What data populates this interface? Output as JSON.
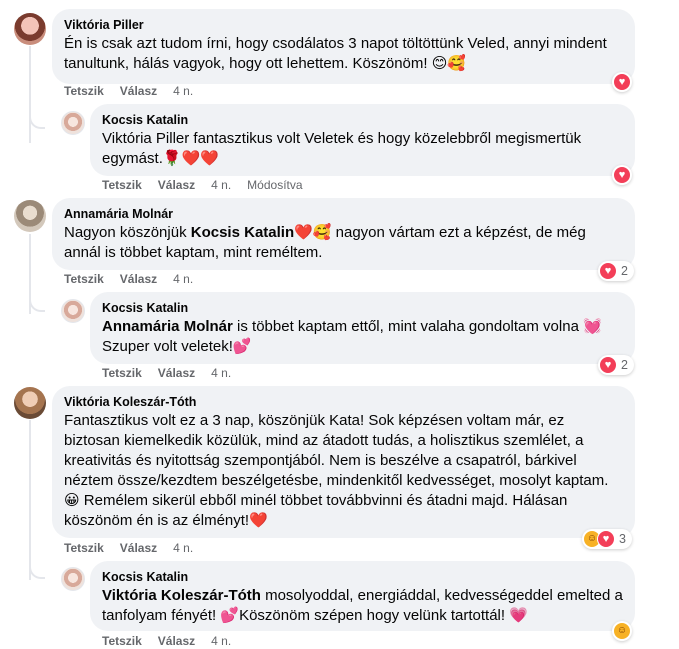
{
  "comments": [
    {
      "author": "Viktória Piller",
      "text": "Én is csak azt tudom írni, hogy csodálatos 3 napot töltöttünk Veled, annyi mindent tanultunk, hálás vagyok, hogy ott lehettem. Köszönöm! 😊🥰",
      "like": "Tetszik",
      "reply": "Válasz",
      "time": "4 n."
    },
    {
      "author": "Kocsis Katalin",
      "text": "Viktória Piller fantasztikus volt Veletek és hogy közelebbről megismertük egymást.🌹❤️❤️",
      "like": "Tetszik",
      "reply": "Válasz",
      "time": "4 n.",
      "edited": "Módosítva"
    },
    {
      "author": "Annamária Molnár",
      "text_before": "Nagyon köszönjük ",
      "mention": "Kocsis Katalin",
      "text_after": "❤️🥰 nagyon vártam ezt a képzést, de még annál is többet kaptam, mint reméltem.",
      "like": "Tetszik",
      "reply": "Válasz",
      "time": "4 n.",
      "reaction_count": "2"
    },
    {
      "author": "Kocsis Katalin",
      "mention": "Annamária Molnár",
      "text_after": " is többet kaptam ettől, mint valaha gondoltam volna 💓 Szuper volt veletek!💕",
      "like": "Tetszik",
      "reply": "Válasz",
      "time": "4 n.",
      "reaction_count": "2"
    },
    {
      "author": "Viktória Koleszár-Tóth",
      "text": "Fantasztikus volt ez a 3 nap, köszönjük Kata! Sok képzésen voltam már, ez biztosan kiemelkedik közülük, mind az átadott tudás, a holisztikus szemlélet, a kreativitás és nyitottság szempontjából. Nem is beszélve a csapatról, bárkivel néztem össze/kezdtem beszélgetésbe, mindenkitől kedvességet, mosolyt kaptam. 😀 Remélem sikerül ebből minél többet továbbvinni és átadni majd. Hálásan köszönöm én is az élményt!❤️",
      "like": "Tetszik",
      "reply": "Válasz",
      "time": "4 n.",
      "reaction_count": "3"
    },
    {
      "author": "Kocsis Katalin",
      "mention": "Viktória Koleszár-Tóth",
      "text_after": " mosolyoddal, energiáddal, kedvességeddel emelted a tanfolyam fényét! 💕Köszönöm szépen hogy velünk tartottál! 💗",
      "like": "Tetszik",
      "reply": "Válasz",
      "time": "4 n."
    }
  ],
  "icons": {
    "heart": "heart-icon",
    "hug": "care-emoji-icon"
  },
  "colors": {
    "bubble": "#f0f2f5",
    "meta": "#65676b",
    "love": "#f33e58",
    "care": "#f7b125"
  }
}
